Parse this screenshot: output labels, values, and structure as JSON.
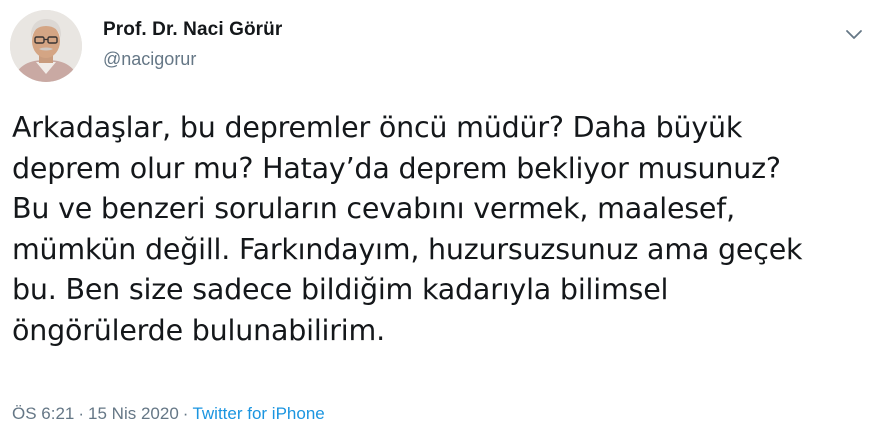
{
  "author": {
    "name": "Prof. Dr. Naci Görür",
    "handle": "@nacigorur"
  },
  "tweet": {
    "lines": [
      "Arkadaşlar, bu depremler öncü müdür? Daha büyük",
      "deprem olur mu? Hatay’da deprem bekliyor musunuz?",
      "Bu ve benzeri soruların cevabını vermek, maalesef,",
      "mümkün değill. Farkındayım, huzursuzsunuz ama geçek",
      "bu. Ben size sadece bildiğim kadarıyla bilimsel",
      "öngörülerde bulunabilirim."
    ]
  },
  "meta": {
    "time": "ÖS 6:21",
    "separator": "·",
    "date": "15 Nis 2020",
    "source": "Twitter for iPhone"
  },
  "icons": {
    "menu": "chevron-down-icon"
  },
  "colors": {
    "text": "#14171a",
    "secondary": "#657786",
    "link": "#1b95e0"
  }
}
